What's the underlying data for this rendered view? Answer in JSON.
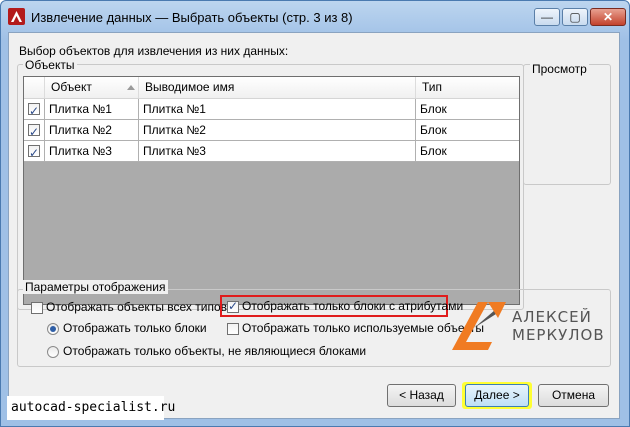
{
  "window": {
    "title": "Извлечение данных — Выбрать объекты (стр. 3 из 8)",
    "controls": {
      "minimize": "—",
      "maximize": "▢",
      "close": "✕"
    }
  },
  "instruction": "Выбор объектов для извлечения из них данных:",
  "objects_group": {
    "title": "Объекты",
    "columns": [
      "Объект",
      "Выводимое имя",
      "Тип"
    ],
    "rows": [
      {
        "checked": true,
        "object": "Плитка №1",
        "display_name": "Плитка №1",
        "type": "Блок"
      },
      {
        "checked": true,
        "object": "Плитка №2",
        "display_name": "Плитка №2",
        "type": "Блок"
      },
      {
        "checked": true,
        "object": "Плитка №3",
        "display_name": "Плитка №3",
        "type": "Блок"
      }
    ]
  },
  "preview": {
    "title": "Просмотр"
  },
  "display_options": {
    "title": "Параметры отображения",
    "show_all_types": {
      "label": "Отображать объекты всех типов",
      "checked": false
    },
    "blocks_only": {
      "label": "Отображать только блоки",
      "checked": true
    },
    "non_blocks_only": {
      "label": "Отображать только объекты, не являющиеся блоками",
      "checked": false
    },
    "blocks_with_attributes": {
      "label": "Отображать только блоки с атрибутами",
      "checked": true
    },
    "used_objects_only": {
      "label": "Отображать только используемые объекты",
      "checked": false
    }
  },
  "logo": {
    "line1": "АЛЕКСЕЙ",
    "line2": "МЕРКУЛОВ",
    "colors": {
      "orange": "#f07b22",
      "gray": "#555555"
    }
  },
  "buttons": {
    "back": "< Назад",
    "next": "Далее >",
    "cancel": "Отмена"
  },
  "watermark": "autocad-specialist.ru",
  "colors": {
    "highlight_red": "#e01c1c",
    "highlight_yellow": "#ffff33",
    "table_empty_bg": "#ababab"
  }
}
